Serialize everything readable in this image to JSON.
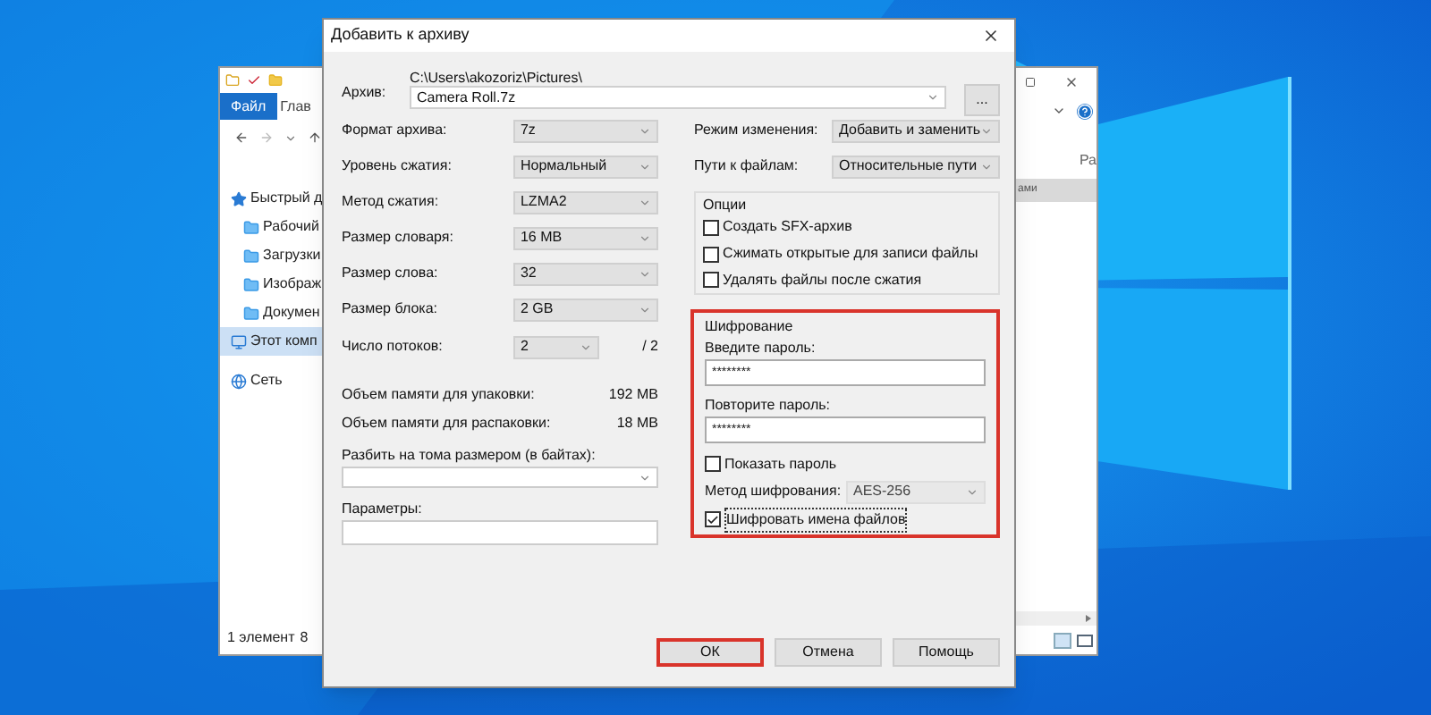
{
  "explorer": {
    "tabs": [
      {
        "label": "Файл",
        "selected": true
      },
      {
        "label": "Глав",
        "selected": false
      }
    ],
    "sidebar": {
      "items": [
        {
          "label": "Быстрый д",
          "kind": "star",
          "selected": false
        },
        {
          "label": "Рабочий",
          "kind": "folder",
          "selected": false
        },
        {
          "label": "Загрузки",
          "kind": "folder",
          "selected": false
        },
        {
          "label": "Изображ",
          "kind": "folder",
          "selected": false
        },
        {
          "label": "Докумен",
          "kind": "folder",
          "selected": false
        },
        {
          "label": "Этот комп",
          "kind": "computer",
          "selected": true
        },
        {
          "label": "Сеть",
          "kind": "network",
          "selected": false
        }
      ]
    },
    "column_header": "Ра",
    "row_text": "ами",
    "status_bar": {
      "count": "1 элемент",
      "column_2": "8"
    }
  },
  "dialog": {
    "title": "Добавить к архиву",
    "archive": {
      "label": "Архив:",
      "folder": "C:\\Users\\akozoriz\\Pictures\\",
      "filename": "Camera Roll.7z",
      "browse": "..."
    },
    "left_settings": [
      {
        "label": "Формат архива:",
        "value": "7z"
      },
      {
        "label": "Уровень сжатия:",
        "value": "Нормальный"
      },
      {
        "label": "Метод сжатия:",
        "value": "LZMA2"
      },
      {
        "label": "Размер словаря:",
        "value": "16 MB"
      },
      {
        "label": "Размер слова:",
        "value": "32"
      },
      {
        "label": "Размер блока:",
        "value": "2 GB"
      }
    ],
    "threads": {
      "label": "Число потоков:",
      "value": "2",
      "max": "/ 2"
    },
    "memory": [
      {
        "label": "Объем памяти для упаковки:",
        "value": "192 MB"
      },
      {
        "label": "Объем памяти для распаковки:",
        "value": "18 MB"
      }
    ],
    "split": {
      "label": "Разбить на тома размером (в байтах):"
    },
    "parameters": {
      "label": "Параметры:"
    },
    "right_settings": [
      {
        "label": "Режим изменения:",
        "value": "Добавить и заменить"
      },
      {
        "label": "Пути к файлам:",
        "value": "Относительные пути"
      }
    ],
    "options": {
      "title": "Опции",
      "items": [
        {
          "label": "Создать SFX-архив",
          "checked": false
        },
        {
          "label": "Сжимать открытые для записи файлы",
          "checked": false
        },
        {
          "label": "Удалять файлы после сжатия",
          "checked": false
        }
      ]
    },
    "encryption": {
      "title": "Шифрование",
      "highlighted": true,
      "password": {
        "label": "Введите пароль:",
        "value": "********"
      },
      "repeat": {
        "label": "Повторите пароль:",
        "value": "********"
      },
      "show_password": {
        "label": "Показать пароль",
        "checked": false
      },
      "method": {
        "label": "Метод шифрования:",
        "value": "AES-256",
        "disabled": true
      },
      "encrypt_names": {
        "label": "Шифровать имена файлов",
        "checked": true
      }
    },
    "buttons": [
      {
        "label": "ОК",
        "highlighted": true
      },
      {
        "label": "Отмена",
        "highlighted": false
      },
      {
        "label": "Помощь",
        "highlighted": false
      }
    ]
  }
}
